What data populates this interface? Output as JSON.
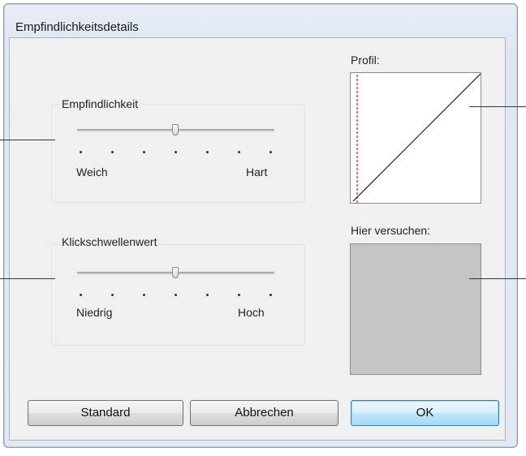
{
  "window": {
    "title": "Empfindlichkeitsdetails"
  },
  "sensitivity": {
    "label": "Empfindlichkeit",
    "min_label": "Weich",
    "max_label": "Hart",
    "value_fraction": 0.5,
    "tick_count": 7
  },
  "click_threshold": {
    "label": "Klickschwellenwert",
    "min_label": "Niedrig",
    "max_label": "Hoch",
    "value_fraction": 0.5,
    "tick_count": 7
  },
  "profile": {
    "label": "Profil:"
  },
  "try_area": {
    "label": "Hier versuchen:"
  },
  "buttons": {
    "standard": "Standard",
    "cancel": "Abbrechen",
    "ok": "OK"
  },
  "colors": {
    "threshold_line": "#cc2222",
    "profile_curve": "#333333",
    "try_area_fill": "#c5c5c5"
  }
}
